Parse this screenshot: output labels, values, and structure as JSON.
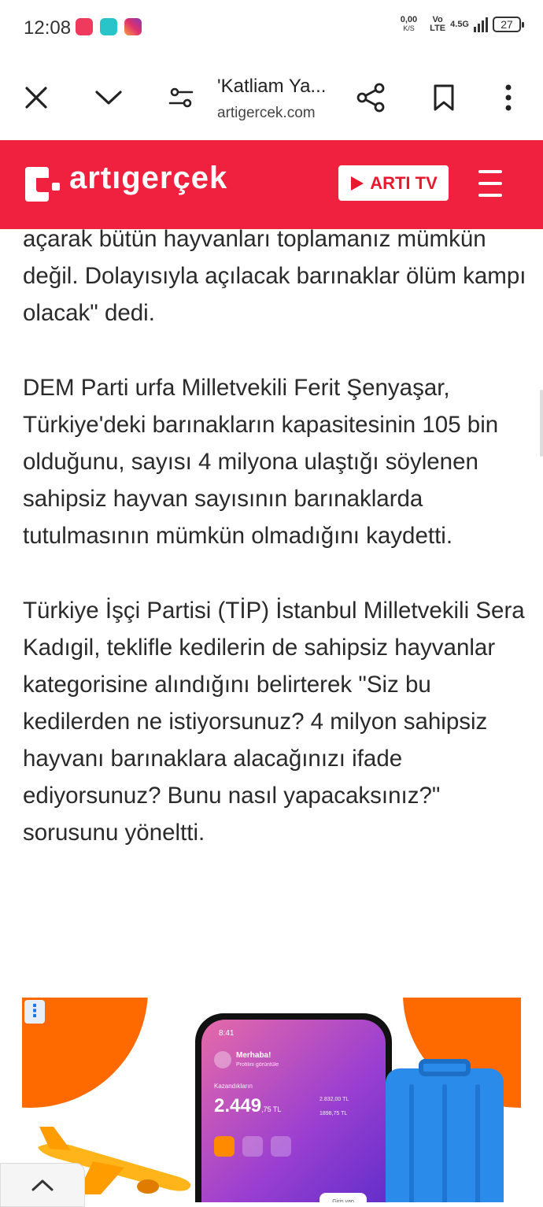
{
  "status_bar": {
    "time": "12:08",
    "net_speed_top": "0,00",
    "net_speed_bottom": "K/S",
    "volte_top": "Vo",
    "volte_bottom": "LTE",
    "network": "4.5G",
    "battery": "27",
    "app_icons": [
      "vivaldi-icon",
      "ghost-app-icon",
      "instagram-icon"
    ]
  },
  "browser": {
    "title": "'Katliam Ya...",
    "url": "artigercek.com"
  },
  "site": {
    "logo_text": "artıgerçek",
    "tv_button_label": "ARTI TV",
    "brand_color": "#f0213e"
  },
  "article": {
    "paragraphs": [
      "açarak bütün hayvanları toplamanız mümkün değil. Dolayısıyla açılacak barınaklar ölüm kampı olacak\" dedi.",
      "DEM Parti urfa Milletvekili Ferit Şenyaşar, Türkiye'deki barınakların kapasitesinin 105 bin olduğunu, sayısı 4 milyona ulaştığı söylenen sahipsiz hayvan sayısının barınaklarda tutulmasının mümkün olmadığını kaydetti.",
      "Türkiye İşçi Partisi (TİP) İstanbul Milletvekili Sera Kadıgil, teklifle kedilerin de sahipsiz hayvanlar kategorisine alındığını belirterek \"Siz bu kedilerden ne istiyorsunuz? 4 milyon sahipsiz hayvanı barınaklara alacağınızı ifade ediyorsunuz? Bunu nasıl yapacaksınız?\" sorusunu yöneltti."
    ]
  },
  "ad": {
    "phone_time": "8:41",
    "greeting": "Merhaba!",
    "greeting_sub": "Profilini görüntüle",
    "label": "Kazandıkların",
    "amount": "2.449",
    "amount_suffix": ",75 TL",
    "side_1": "2.832,00 TL",
    "side_2": "1898,75 TL",
    "chip": "Giriş yap"
  }
}
